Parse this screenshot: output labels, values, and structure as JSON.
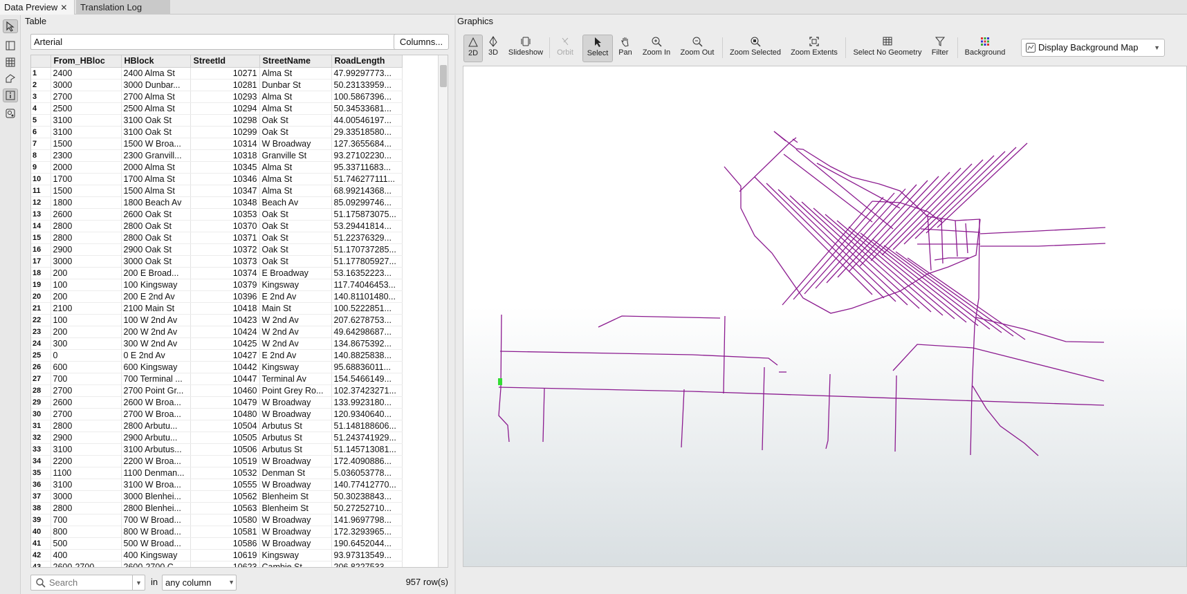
{
  "tabs": [
    {
      "label": "Data Preview",
      "active": true
    },
    {
      "label": "Translation Log",
      "active": false
    }
  ],
  "left_tools": [
    "select-icon",
    "data-preview-icon",
    "table-icon",
    "geometry-icon",
    "info-icon",
    "settings-icon"
  ],
  "table_panel": {
    "title": "Table",
    "layer": "Arterial",
    "columns_button": "Columns...",
    "headers": [
      "From_HBloc",
      "HBlock",
      "StreetId",
      "StreetName",
      "RoadLength"
    ],
    "rows": [
      [
        "1",
        "2400",
        "2400 Alma St",
        "10271",
        "Alma St",
        "47.99297773..."
      ],
      [
        "2",
        "3000",
        "3000 Dunbar...",
        "10281",
        "Dunbar St",
        "50.23133959..."
      ],
      [
        "3",
        "2700",
        "2700 Alma St",
        "10293",
        "Alma St",
        "100.5867396..."
      ],
      [
        "4",
        "2500",
        "2500 Alma St",
        "10294",
        "Alma St",
        "50.34533681..."
      ],
      [
        "5",
        "3100",
        "3100 Oak St",
        "10298",
        "Oak St",
        "44.00546197..."
      ],
      [
        "6",
        "3100",
        "3100 Oak St",
        "10299",
        "Oak St",
        "29.33518580..."
      ],
      [
        "7",
        "1500",
        "1500 W Broa...",
        "10314",
        "W Broadway",
        "127.3655684..."
      ],
      [
        "8",
        "2300",
        "2300 Granvill...",
        "10318",
        "Granville St",
        "93.27102230..."
      ],
      [
        "9",
        "2000",
        "2000 Alma St",
        "10345",
        "Alma St",
        "95.33711683..."
      ],
      [
        "10",
        "1700",
        "1700 Alma St",
        "10346",
        "Alma St",
        "51.746277111..."
      ],
      [
        "11",
        "1500",
        "1500 Alma St",
        "10347",
        "Alma St",
        "68.99214368..."
      ],
      [
        "12",
        "1800",
        "1800 Beach Av",
        "10348",
        "Beach Av",
        "85.09299746..."
      ],
      [
        "13",
        "2600",
        "2600 Oak St",
        "10353",
        "Oak St",
        "51.175873075..."
      ],
      [
        "14",
        "2800",
        "2800 Oak St",
        "10370",
        "Oak St",
        "53.29441814..."
      ],
      [
        "15",
        "2800",
        "2800 Oak St",
        "10371",
        "Oak St",
        "51.22376329..."
      ],
      [
        "16",
        "2900",
        "2900 Oak St",
        "10372",
        "Oak St",
        "51.170737285..."
      ],
      [
        "17",
        "3000",
        "3000 Oak St",
        "10373",
        "Oak St",
        "51.177805927..."
      ],
      [
        "18",
        "200",
        "200 E Broad...",
        "10374",
        "E Broadway",
        "53.16352223..."
      ],
      [
        "19",
        "100",
        "100 Kingsway",
        "10379",
        "Kingsway",
        "117.74046453..."
      ],
      [
        "20",
        "200",
        "200 E 2nd Av",
        "10396",
        "E 2nd Av",
        "140.81101480..."
      ],
      [
        "21",
        "2100",
        "2100 Main St",
        "10418",
        "Main St",
        "100.5222851..."
      ],
      [
        "22",
        "100",
        "100 W 2nd Av",
        "10423",
        "W 2nd Av",
        "207.6278753..."
      ],
      [
        "23",
        "200",
        "200 W 2nd Av",
        "10424",
        "W 2nd Av",
        "49.64298687..."
      ],
      [
        "24",
        "300",
        "300 W 2nd Av",
        "10425",
        "W 2nd Av",
        "134.8675392..."
      ],
      [
        "25",
        "0",
        "0 E 2nd Av",
        "10427",
        "E 2nd Av",
        "140.8825838..."
      ],
      [
        "26",
        "600",
        "600 Kingsway",
        "10442",
        "Kingsway",
        "95.68836011..."
      ],
      [
        "27",
        "700",
        "700 Terminal ...",
        "10447",
        "Terminal Av",
        "154.5466149..."
      ],
      [
        "28",
        "2700",
        "2700 Point Gr...",
        "10460",
        "Point Grey Ro...",
        "102.37423271..."
      ],
      [
        "29",
        "2600",
        "2600 W Broa...",
        "10479",
        "W Broadway",
        "133.9923180..."
      ],
      [
        "30",
        "2700",
        "2700 W Broa...",
        "10480",
        "W Broadway",
        "120.9340640..."
      ],
      [
        "31",
        "2800",
        "2800 Arbutu...",
        "10504",
        "Arbutus St",
        "51.148188606..."
      ],
      [
        "32",
        "2900",
        "2900 Arbutu...",
        "10505",
        "Arbutus St",
        "51.243741929..."
      ],
      [
        "33",
        "3100",
        "3100 Arbutus...",
        "10506",
        "Arbutus St",
        "51.145713081..."
      ],
      [
        "34",
        "2200",
        "2200 W Broa...",
        "10519",
        "W Broadway",
        "172.4090886..."
      ],
      [
        "35",
        "1100",
        "1100 Denman...",
        "10532",
        "Denman St",
        "5.036053778..."
      ],
      [
        "36",
        "3100",
        "3100 W Broa...",
        "10555",
        "W Broadway",
        "140.77412770..."
      ],
      [
        "37",
        "3000",
        "3000 Blenhei...",
        "10562",
        "Blenheim St",
        "50.30238843..."
      ],
      [
        "38",
        "2800",
        "2800 Blenhei...",
        "10563",
        "Blenheim St",
        "50.27252710..."
      ],
      [
        "39",
        "700",
        "700 W Broad...",
        "10580",
        "W Broadway",
        "141.9697798..."
      ],
      [
        "40",
        "800",
        "800 W Broad...",
        "10581",
        "W Broadway",
        "172.3293965..."
      ],
      [
        "41",
        "500",
        "500 W Broad...",
        "10586",
        "W Broadway",
        "190.6452044..."
      ],
      [
        "42",
        "400",
        "400 Kingsway",
        "10619",
        "Kingsway",
        "93.97313549..."
      ],
      [
        "43",
        "2600-2700",
        "2600-2700 C...",
        "10623",
        "Cambie St",
        "206.8227533..."
      ]
    ],
    "search_placeholder": "Search",
    "in_label": "in",
    "column_filter": "any column",
    "row_count": "957 row(s)"
  },
  "graphics_panel": {
    "title": "Graphics",
    "toolbar": [
      {
        "label": "2D",
        "icon": "2d-icon",
        "selected": true,
        "disabled": false
      },
      {
        "label": "3D",
        "icon": "3d-icon",
        "selected": false,
        "disabled": false
      },
      {
        "label": "Slideshow",
        "icon": "slideshow-icon",
        "selected": false,
        "disabled": false
      },
      {
        "label": "Orbit",
        "icon": "orbit-icon",
        "selected": false,
        "disabled": true
      },
      {
        "label": "Select",
        "icon": "cursor-icon",
        "selected": true,
        "disabled": false
      },
      {
        "label": "Pan",
        "icon": "hand-icon",
        "selected": false,
        "disabled": false
      },
      {
        "label": "Zoom In",
        "icon": "zoom-in-icon",
        "selected": false,
        "disabled": false
      },
      {
        "label": "Zoom Out",
        "icon": "zoom-out-icon",
        "selected": false,
        "disabled": false
      },
      {
        "label": "Zoom Selected",
        "icon": "zoom-selected-icon",
        "selected": false,
        "disabled": false
      },
      {
        "label": "Zoom Extents",
        "icon": "zoom-extents-icon",
        "selected": false,
        "disabled": false
      },
      {
        "label": "Select No Geometry",
        "icon": "table-select-icon",
        "selected": false,
        "disabled": false
      },
      {
        "label": "Filter",
        "icon": "filter-icon",
        "selected": false,
        "disabled": false
      },
      {
        "label": "Background",
        "icon": "background-grid-icon",
        "selected": false,
        "disabled": false
      }
    ],
    "background_map": "Display Background Map",
    "line_color": "#8b1a8f",
    "highlight_color": "#33dd33"
  }
}
